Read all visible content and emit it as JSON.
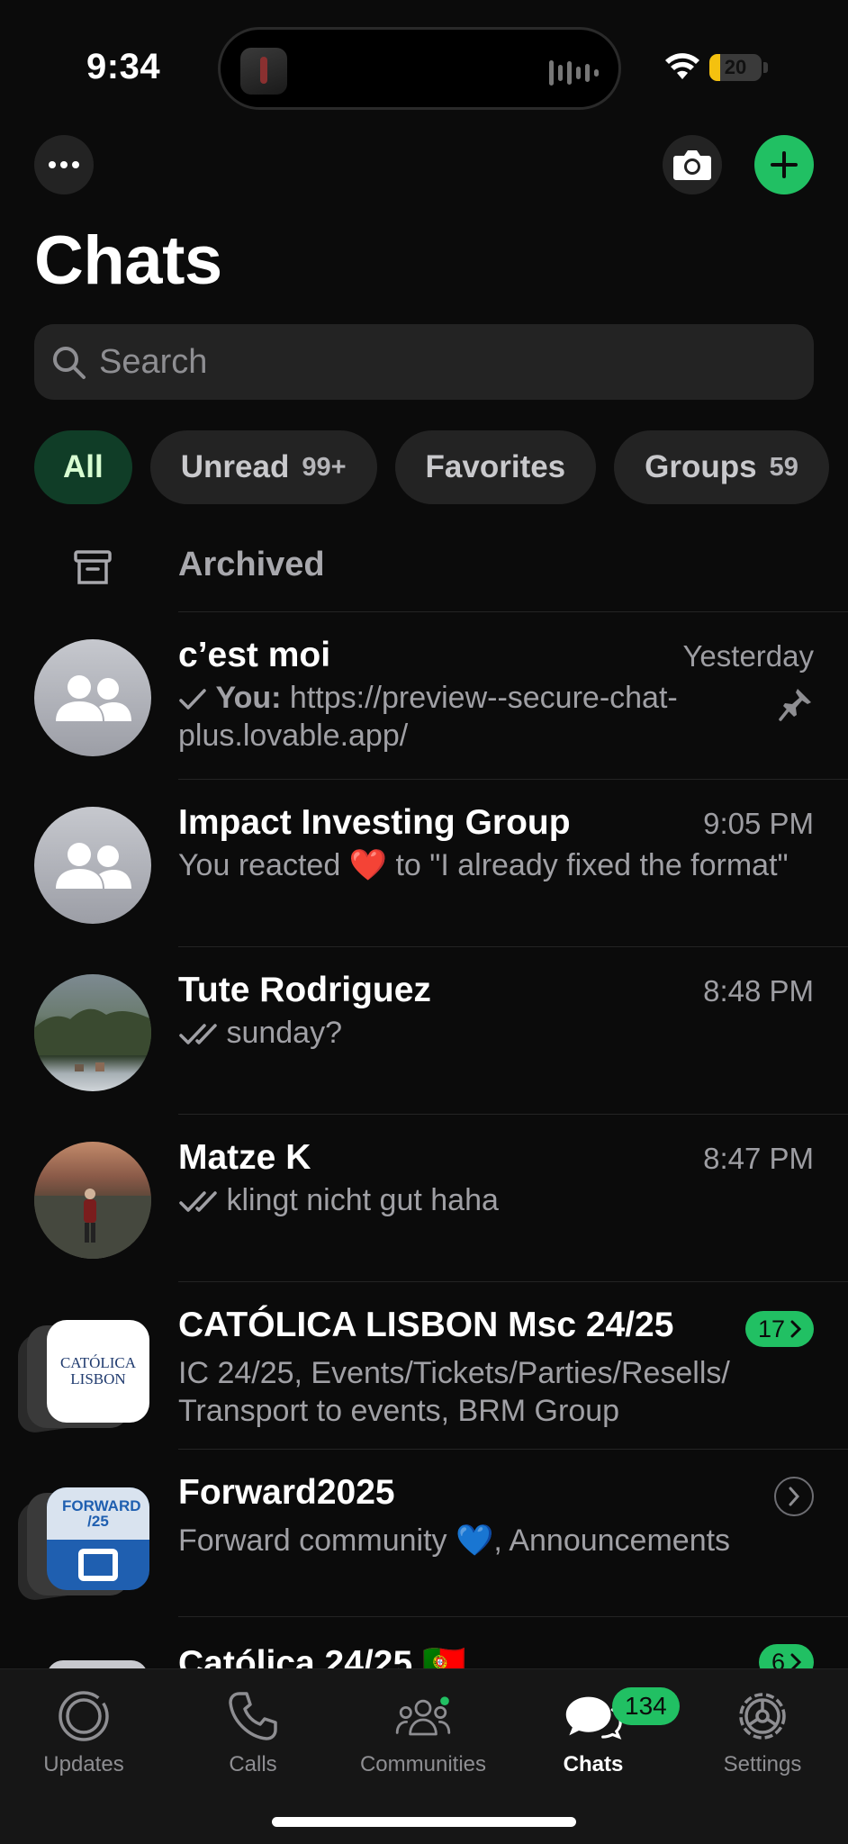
{
  "status_bar": {
    "time": "9:34",
    "battery_level": "20",
    "battery_fraction": 0.2
  },
  "header": {
    "title": "Chats",
    "more_icon": "ellipsis-icon",
    "camera_icon": "camera-icon",
    "new_chat_icon": "plus-icon"
  },
  "search": {
    "placeholder": "Search"
  },
  "filters": [
    {
      "label": "All",
      "count": "",
      "active": true
    },
    {
      "label": "Unread",
      "count": "99+",
      "active": false
    },
    {
      "label": "Favorites",
      "count": "",
      "active": false
    },
    {
      "label": "Groups",
      "count": "59",
      "active": false
    }
  ],
  "archived": {
    "label": "Archived"
  },
  "chats": [
    {
      "name": "c’est moi",
      "time": "Yesterday",
      "sender": "You:",
      "preview": "https://preview--secure-chat-plus.lovable.app/",
      "pinned": true
    },
    {
      "name": "Impact Investing Group",
      "time": "9:05 PM",
      "preview_before": "You reacted ",
      "emoji": "❤️",
      "preview_after": " to \"I already fixed the format\""
    },
    {
      "name": "Tute Rodriguez",
      "time": "8:48 PM",
      "preview": "sunday?"
    },
    {
      "name": "Matze K",
      "time": "8:47 PM",
      "preview": "klingt nicht gut haha"
    },
    {
      "name": "CATÓLICA LISBON Msc 24/25",
      "unread": "17",
      "preview": "IC 24/25, Events/Tickets/Parties/Resells/ Transport to events, BRM Group",
      "logo_text": "CATÓLICA LISBON"
    },
    {
      "name": "Forward2025",
      "preview_before": "Forward community ",
      "emoji": "💙",
      "preview_after": ", Announcements",
      "logo_text": "FORWARD /25"
    },
    {
      "name": "Católica 24/25 🇵🇹",
      "unread": "6"
    }
  ],
  "tabs": [
    {
      "label": "Updates",
      "icon": "updates-icon"
    },
    {
      "label": "Calls",
      "icon": "phone-icon"
    },
    {
      "label": "Communities",
      "icon": "communities-icon"
    },
    {
      "label": "Chats",
      "icon": "chats-icon",
      "badge": "134",
      "active": true
    },
    {
      "label": "Settings",
      "icon": "settings-icon"
    }
  ],
  "colors": {
    "accent": "#21c063",
    "background": "#0b0b0b",
    "chip_active": "#103d27"
  }
}
